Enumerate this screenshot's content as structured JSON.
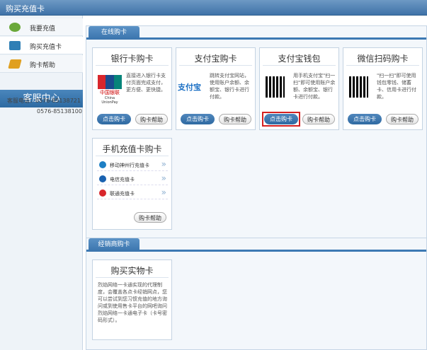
{
  "header": {
    "title": "购买充值卡"
  },
  "sidebar": {
    "items": [
      {
        "label": "我要充值"
      },
      {
        "label": "购买充值卡"
      },
      {
        "label": "购卡帮助"
      }
    ],
    "service_title": "客服中心",
    "phone_label": "客服电话：0576-85138721",
    "phone2": "0576-85138100"
  },
  "online": {
    "tab": "在线购卡",
    "cards": [
      {
        "title": "银行卡购卡",
        "desc": "直接进入银行卡支付页面完成支付，更方便、更快捷。",
        "buy": "点击购卡",
        "help": "购卡帮助",
        "logo_text": "中国银联",
        "logo_sub": "China UnionPay"
      },
      {
        "title": "支付宝购卡",
        "desc": "跳转支付宝网站，使用账户余额、余额宝、银行卡进行付款。",
        "buy": "点击购卡",
        "help": "购卡帮助",
        "logo_text": "支付宝"
      },
      {
        "title": "支付宝钱包",
        "desc": "用手机支付宝\"扫一扫\"即可使用账户余额、余额宝、银行卡进行付款。",
        "buy": "点击购卡",
        "help": "购卡帮助"
      },
      {
        "title": "微信扫码购卡",
        "desc": "\"扫一扫\"即可使用钱包零钱、储蓄卡、信用卡进行付款。",
        "buy": "点击购卡",
        "help": "购卡帮助"
      }
    ],
    "mobile": {
      "title": "手机充值卡购卡",
      "operators": [
        "移动神州行充值卡",
        "电信充值卡",
        "联通充值卡"
      ],
      "help": "购卡帮助"
    }
  },
  "dealer": {
    "tab": "经销商购卡",
    "card_title": "购买实物卡",
    "desc": "烈焰网络一卡通实现的代理制度，会覆盖各点卡经销网点，您可以尝试到您习惯充值的地方询问或到使用售卡平台的网吧询问烈焰网络一卡通电子卡（卡号密码形式）。"
  },
  "colors": {
    "accent": "#3c79b3",
    "highlight": "#d42020"
  }
}
